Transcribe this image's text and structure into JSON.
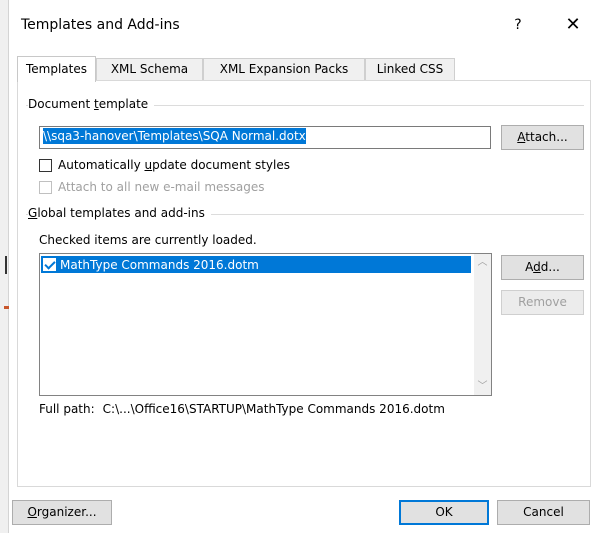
{
  "window": {
    "title": "Templates and Add-ins",
    "help_glyph": "?",
    "close_glyph": "✕"
  },
  "tabs": [
    {
      "label": "Templates",
      "active": true
    },
    {
      "label": "XML Schema",
      "active": false
    },
    {
      "label": "XML Expansion Packs",
      "active": false
    },
    {
      "label": "Linked CSS",
      "active": false
    }
  ],
  "document_template": {
    "group_label_pre": "Document ",
    "group_label_key": "t",
    "group_label_post": "emplate",
    "path_value": "\\\\sqa3-hanover\\Templates\\SQA Normal.dotx",
    "attach_pre": "",
    "attach_key": "A",
    "attach_post": "ttach...",
    "auto_update": {
      "pre": "Automatically ",
      "key": "u",
      "post": "pdate document styles",
      "checked": false,
      "enabled": true
    },
    "attach_email": {
      "label": "Attach to all new e-mail messages",
      "checked": false,
      "enabled": false
    }
  },
  "global_templates": {
    "group_label_pre": "",
    "group_label_key": "G",
    "group_label_post": "lobal templates and add-ins",
    "hint": "Checked items are currently loaded.",
    "items": [
      {
        "label": "MathType Commands 2016.dotm",
        "checked": true,
        "selected": true
      }
    ],
    "add_pre": "A",
    "add_key": "d",
    "add_post": "d...",
    "remove_label": "Remove",
    "full_path_label": "Full path:",
    "full_path_value": "C:\\...\\Office16\\STARTUP\\MathType Commands 2016.dotm"
  },
  "footer": {
    "organizer_pre": "",
    "organizer_key": "O",
    "organizer_post": "rganizer...",
    "ok_label": "OK",
    "cancel_label": "Cancel"
  },
  "colors": {
    "accent": "#0078d7",
    "button_face": "#e1e1e1",
    "disabled_text": "#a0a0a0"
  }
}
